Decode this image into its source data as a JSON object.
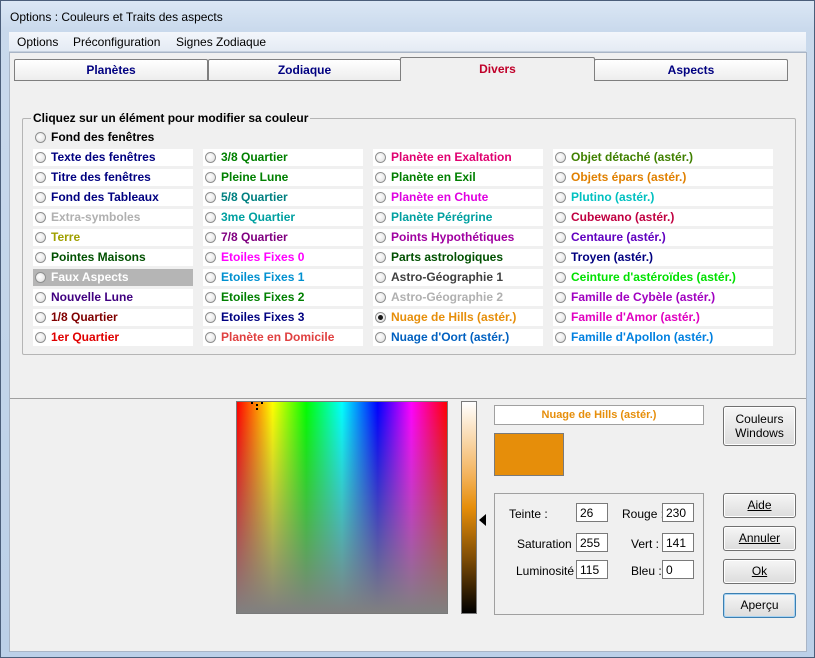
{
  "window": {
    "title": "Options :  Couleurs et Traits des aspects"
  },
  "menu": [
    "Options",
    "Préconfiguration",
    "Signes Zodiaque"
  ],
  "tabs": [
    "Planètes",
    "Zodiaque",
    "Divers",
    "Aspects"
  ],
  "active_tab": "Divers",
  "group_title": "Cliquez sur un élément pour modifier sa couleur",
  "top_item": {
    "label": "Fond des fenêtres",
    "color": "#000000"
  },
  "columns": [
    [
      {
        "label": "Texte des fenêtres",
        "color": "#000080"
      },
      {
        "label": "Titre des fenêtres",
        "color": "#000080"
      },
      {
        "label": "Fond des Tableaux",
        "color": "#000080"
      },
      {
        "label": "Extra-symboles",
        "color": "#b0b0b0"
      },
      {
        "label": "Terre",
        "color": "#a0a000"
      },
      {
        "label": "Pointes Maisons",
        "color": "#005000"
      },
      {
        "label": "Faux Aspects",
        "color": "#ffffff"
      },
      {
        "label": "Nouvelle Lune",
        "color": "#400080"
      },
      {
        "label": "1/8 Quartier",
        "color": "#800000"
      },
      {
        "label": "1er Quartier",
        "color": "#e00000"
      }
    ],
    [
      {
        "label": "3/8 Quartier",
        "color": "#008000"
      },
      {
        "label": "Pleine Lune",
        "color": "#008000"
      },
      {
        "label": "5/8 Quartier",
        "color": "#008080"
      },
      {
        "label": "3me Quartier",
        "color": "#00a0a0"
      },
      {
        "label": "7/8 Quartier",
        "color": "#800080"
      },
      {
        "label": "Etoiles Fixes 0",
        "color": "#ff00ff"
      },
      {
        "label": "Etoiles Fixes 1",
        "color": "#0090d0"
      },
      {
        "label": "Etoiles Fixes 2",
        "color": "#008000"
      },
      {
        "label": "Etoiles Fixes 3",
        "color": "#000080"
      },
      {
        "label": "Planète en Domicile",
        "color": "#e04040"
      }
    ],
    [
      {
        "label": "Planète en Exaltation",
        "color": "#e00070"
      },
      {
        "label": "Planète en Exil",
        "color": "#008000"
      },
      {
        "label": "Planète en Chute",
        "color": "#e000e0"
      },
      {
        "label": "Planète Pérégrine",
        "color": "#00a0a0"
      },
      {
        "label": "Points Hypothétiques",
        "color": "#a000a0"
      },
      {
        "label": "Parts astrologiques",
        "color": "#005000"
      },
      {
        "label": "Astro-Géographie 1",
        "color": "#404040"
      },
      {
        "label": "Astro-Géographie 2",
        "color": "#b0b0b0"
      },
      {
        "label": "Nuage de Hills (astér.)",
        "color": "#e68e0a"
      },
      {
        "label": "Nuage d'Oort (astér.)",
        "color": "#0060c0"
      }
    ],
    [
      {
        "label": "Objet détaché (astér.)",
        "color": "#408000"
      },
      {
        "label": "Objets épars (astér.)",
        "color": "#e08000"
      },
      {
        "label": "Plutino (astér.)",
        "color": "#00c0c0"
      },
      {
        "label": "Cubewano (astér.)",
        "color": "#c00040"
      },
      {
        "label": "Centaure (astér.)",
        "color": "#6000c0"
      },
      {
        "label": "Troyen (astér.)",
        "color": "#000080"
      },
      {
        "label": "Ceinture d'astéroïdes (astér.)",
        "color": "#00e000"
      },
      {
        "label": "Famille de Cybèle (astér.)",
        "color": "#a000c0"
      },
      {
        "label": "Famille d'Amor (astér.)",
        "color": "#e000c0"
      },
      {
        "label": "Famille d'Apollon (astér.)",
        "color": "#0080e0"
      }
    ]
  ],
  "selected_item": "Nuage de Hills (astér.)",
  "highlighted_item": "Faux Aspects",
  "picker": {
    "name": "Nuage de Hills (astér.)",
    "swatch_color": "#e68e0a",
    "teinte_label": "Teinte :",
    "teinte": "26",
    "saturation_label": "Saturation :",
    "saturation": "255",
    "luminosite_label": "Luminosité :",
    "luminosite": "115",
    "rouge_label": "Rouge :",
    "rouge": "230",
    "vert_label": "Vert :",
    "vert": "141",
    "bleu_label": "Bleu :",
    "bleu": "0"
  },
  "buttons": {
    "windows_colors_1": "Couleurs",
    "windows_colors_2": "Windows",
    "help": "Aide",
    "cancel": "Annuler",
    "ok": "Ok",
    "preview": "Aperçu"
  }
}
